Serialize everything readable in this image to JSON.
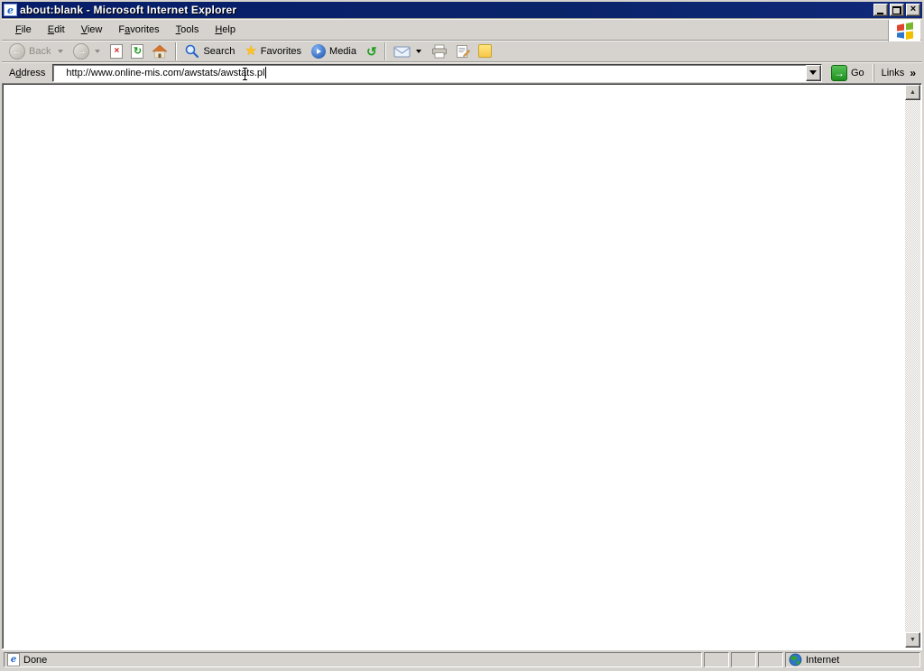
{
  "colors": {
    "chrome": "#d6d3ce",
    "titlebar_blue": "#0a246a",
    "go_green": "#1e8f1e",
    "stop_red": "#d42020",
    "favorites_gold": "#ffc31f"
  },
  "titlebar": {
    "title": "about:blank - Microsoft Internet Explorer",
    "icon_letter": "e",
    "buttons": {
      "close_glyph": "×"
    }
  },
  "menubar": {
    "items": [
      {
        "pre": "",
        "key": "F",
        "post": "ile"
      },
      {
        "pre": "",
        "key": "E",
        "post": "dit"
      },
      {
        "pre": "",
        "key": "V",
        "post": "iew"
      },
      {
        "pre": "F",
        "key": "a",
        "post": "vorites"
      },
      {
        "pre": "",
        "key": "T",
        "post": "ools"
      },
      {
        "pre": "",
        "key": "H",
        "post": "elp"
      }
    ]
  },
  "toolbar": {
    "back_label": "Back",
    "back_arrow": "←",
    "forward_arrow": "→",
    "stop_glyph": "×",
    "refresh_glyph": "↻",
    "history_glyph": "↺",
    "star_glyph": "★",
    "search_label": "Search",
    "favorites_label": "Favorites",
    "media_label": "Media"
  },
  "addressbar": {
    "label_pre": "A",
    "label_key": "d",
    "label_post": "dress",
    "value": "http://www.online-mis.com/awstats/awstats.pl",
    "go_label": "Go",
    "go_arrow": "→",
    "links_label": "Links",
    "links_chevron": "»"
  },
  "scrollbar": {
    "up_glyph": "▲",
    "down_glyph": "▼"
  },
  "statusbar": {
    "status": "Done",
    "icon_letter": "e",
    "zone": "Internet"
  }
}
